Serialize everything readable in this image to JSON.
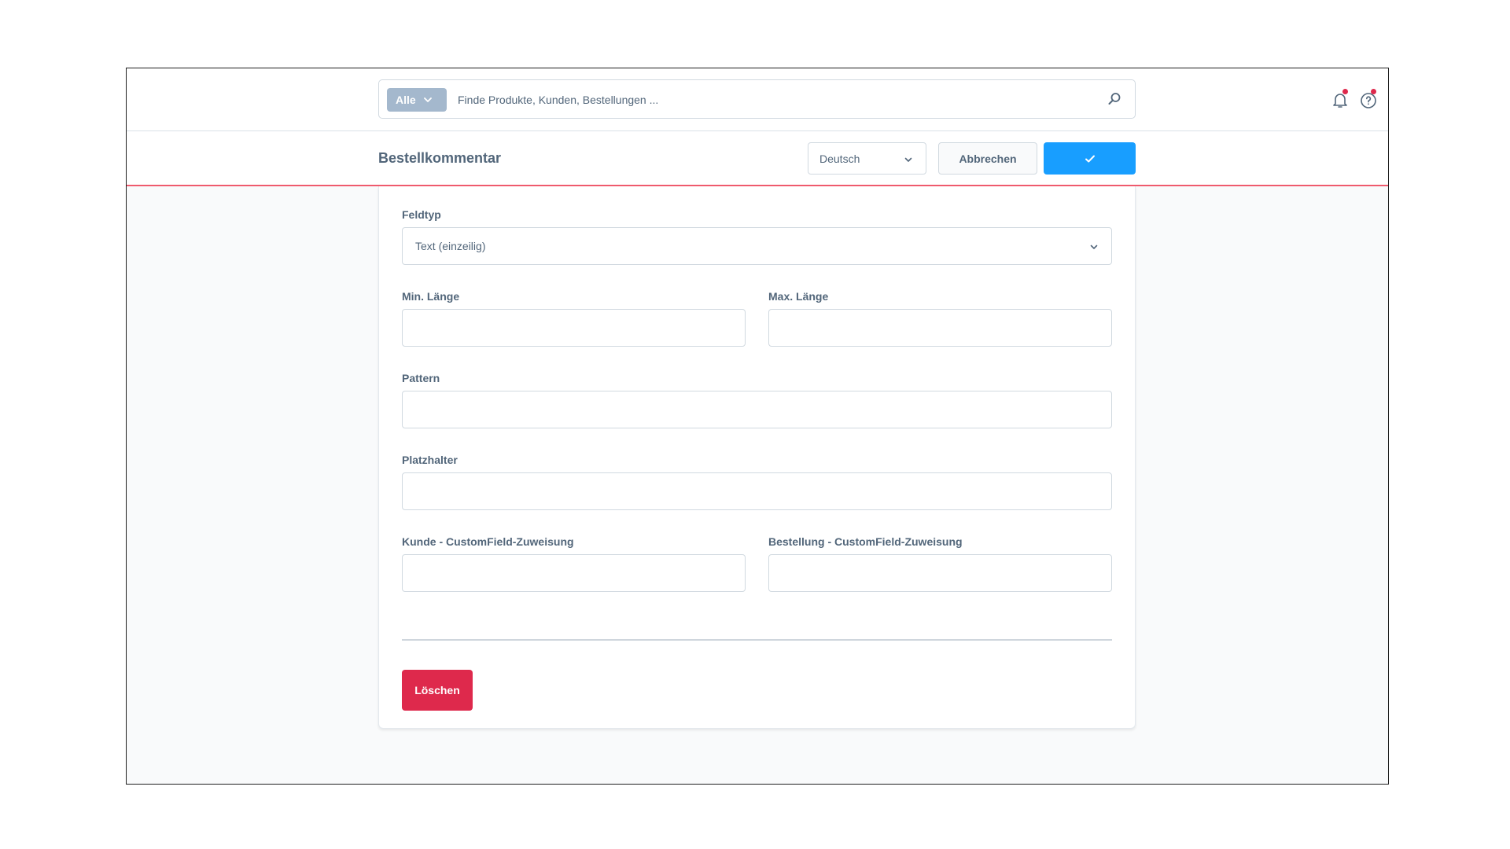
{
  "search": {
    "type_label": "Alle",
    "placeholder": "Finde Produkte, Kunden, Bestellungen ..."
  },
  "header": {
    "title": "Bestellkommentar",
    "language": "Deutsch",
    "cancel_label": "Abbrechen"
  },
  "form": {
    "field_type": {
      "label": "Feldtyp",
      "value": "Text (einzeilig)"
    },
    "min_length": {
      "label": "Min. Länge",
      "value": ""
    },
    "max_length": {
      "label": "Max. Länge",
      "value": ""
    },
    "pattern": {
      "label": "Pattern",
      "value": ""
    },
    "placeholder": {
      "label": "Platzhalter",
      "value": ""
    },
    "customer_assignment": {
      "label": "Kunde - CustomField-Zuweisung",
      "value": ""
    },
    "order_assignment": {
      "label": "Bestellung - CustomField-Zuweisung",
      "value": ""
    },
    "delete_label": "Löschen"
  },
  "colors": {
    "primary": "#189eff",
    "danger": "#de294c",
    "accent_border": "#ef5a6d",
    "text": "#52667a",
    "search_type_bg": "#a4b8cd"
  },
  "icons": {
    "search": "search-icon",
    "notifications": "bell-icon",
    "help": "help-icon",
    "confirm": "checkmark-icon",
    "dropdown": "chevron-down-icon"
  }
}
